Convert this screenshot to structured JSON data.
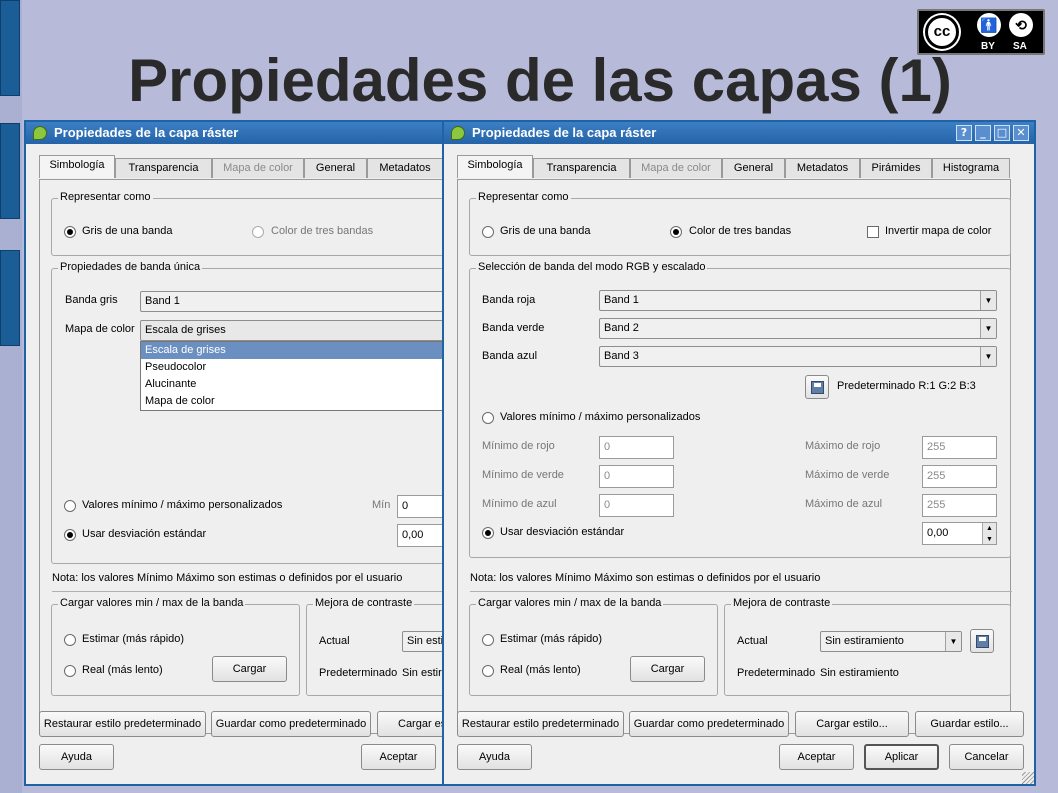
{
  "slide": {
    "title": "Propiedades de las capas (1)",
    "cc_badge": {
      "text": "cc",
      "by": "BY",
      "sa": "SA"
    }
  },
  "left_dialog": {
    "title": "Propiedades de la capa ráster",
    "tabs": [
      "Simbología",
      "Transparencia",
      "Mapa de color",
      "General",
      "Metadatos"
    ],
    "render_group": {
      "label": "Representar como",
      "opt1": "Gris de una banda",
      "opt2": "Color de tres bandas"
    },
    "single_band_group": {
      "label": "Propiedades de banda única",
      "gray_band_label": "Banda gris",
      "gray_band_value": "Band 1",
      "color_map_label": "Mapa de color",
      "color_map_value": "Escala de grises",
      "color_map_options": [
        "Escala de grises",
        "Pseudocolor",
        "Alucinante",
        "Mapa de color"
      ],
      "custom_minmax_label": "Valores mínimo / máximo personalizados",
      "min_label": "Mín",
      "min_value": "0",
      "std_dev_label": "Usar desviación estándar",
      "std_dev_value": "0,00"
    },
    "note": "Nota: los valores Mínimo Máximo son estimas o definidos por el usuario",
    "load_group": {
      "label": "Cargar valores min / max de la banda",
      "estimate": "Estimar (más rápido)",
      "real": "Real (más lento)",
      "load_button": "Cargar"
    },
    "contrast_group": {
      "label": "Mejora de contraste",
      "current_label": "Actual",
      "current_value": "Sin estiramiento",
      "default_label": "Predeterminado",
      "default_value": "Sin estiramiento"
    },
    "buttons": {
      "restore": "Restaurar estilo predeterminado",
      "save_default": "Guardar como predeterminado",
      "load_style": "Cargar estilo...",
      "help": "Ayuda",
      "accept": "Aceptar"
    }
  },
  "right_dialog": {
    "title": "Propiedades de la capa ráster",
    "title_buttons": [
      "?",
      "_",
      "□",
      "✕"
    ],
    "tabs": [
      "Simbología",
      "Transparencia",
      "Mapa de color",
      "General",
      "Metadatos",
      "Pirámides",
      "Histograma"
    ],
    "render_group": {
      "label": "Representar como",
      "opt1": "Gris de una banda",
      "opt2": "Color de tres bandas",
      "invert": "Invertir mapa de color"
    },
    "rgb_group": {
      "label": "Selección de banda del modo RGB y escalado",
      "red_label": "Banda roja",
      "red_value": "Band 1",
      "green_label": "Banda verde",
      "green_value": "Band 2",
      "blue_label": "Banda azul",
      "blue_value": "Band 3",
      "default_text": "Predeterminado R:1 G:2 B:3",
      "custom_minmax_label": "Valores mínimo / máximo personalizados",
      "min_red_label": "Mínimo de rojo",
      "min_red_value": "0",
      "min_green_label": "Mínimo de verde",
      "min_green_value": "0",
      "min_blue_label": "Mínimo de azul",
      "min_blue_value": "0",
      "max_red_label": "Máximo de rojo",
      "max_red_value": "255",
      "max_green_label": "Máximo de verde",
      "max_green_value": "255",
      "max_blue_label": "Máximo de azul",
      "max_blue_value": "255",
      "std_dev_label": "Usar desviación estándar",
      "std_dev_value": "0,00"
    },
    "note": "Nota: los valores Mínimo Máximo son estimas o definidos por el usuario",
    "load_group": {
      "label": "Cargar valores min / max de la banda",
      "estimate": "Estimar (más rápido)",
      "real": "Real (más lento)",
      "load_button": "Cargar"
    },
    "contrast_group": {
      "label": "Mejora de contraste",
      "current_label": "Actual",
      "current_value": "Sin estiramiento",
      "default_label": "Predeterminado",
      "default_value": "Sin estiramiento"
    },
    "buttons": {
      "restore": "Restaurar estilo predeterminado",
      "save_default": "Guardar como predeterminado",
      "load_style": "Cargar estilo...",
      "save_style": "Guardar estilo...",
      "help": "Ayuda",
      "accept": "Aceptar",
      "apply": "Aplicar",
      "cancel": "Cancelar"
    }
  }
}
